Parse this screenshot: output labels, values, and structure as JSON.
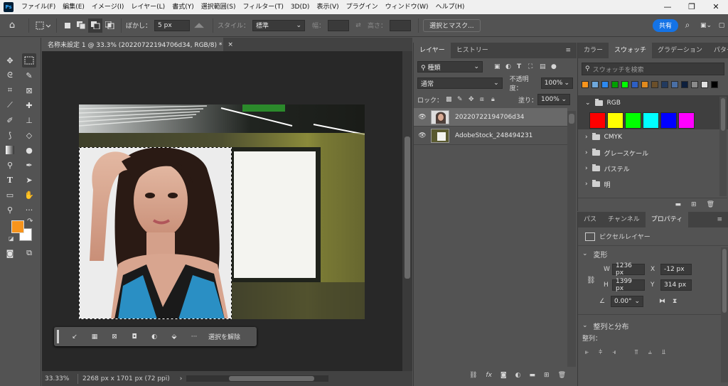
{
  "app": {
    "logo": "Ps"
  },
  "menu": [
    "ファイル(F)",
    "編集(E)",
    "イメージ(I)",
    "レイヤー(L)",
    "書式(Y)",
    "選択範囲(S)",
    "フィルター(T)",
    "3D(D)",
    "表示(V)",
    "プラグイン",
    "ウィンドウ(W)",
    "ヘルプ(H)"
  ],
  "window_controls": {
    "minimize": "—",
    "restore": "❐",
    "close": "✕"
  },
  "options": {
    "feather_label": "ぼかし：",
    "feather_value": "5 px",
    "style_label": "スタイル：",
    "style_value": "標準",
    "width_label": "幅：",
    "height_label": "高さ：",
    "select_mask": "選択とマスク...",
    "share": "共有"
  },
  "document": {
    "tab_title": "名称未設定 1 @ 33.3% (20220722194706d34, RGB/8) *",
    "zoom": "33.33%",
    "dimensions": "2268 px x 1701 px (72 ppi)"
  },
  "context_bar": {
    "deselect": "選択を解除"
  },
  "layers_panel": {
    "tabs": [
      "レイヤー",
      "ヒストリー"
    ],
    "filter_kind": "種類",
    "blend_mode": "通常",
    "opacity_label": "不透明度：",
    "opacity_value": "100%",
    "lock_label": "ロック：",
    "fill_label": "塗り：",
    "fill_value": "100%",
    "layers": [
      {
        "name": "20220722194706d34",
        "selected": true
      },
      {
        "name": "AdobeStock_248494231",
        "selected": false
      }
    ]
  },
  "swatches_panel": {
    "tabs": [
      "カラー",
      "スウォッチ",
      "グラデーション",
      "パターン"
    ],
    "search_placeholder": "スウォッチを検索",
    "recent_colors": [
      "#f7941d",
      "#6fa8dc",
      "#2d89ef",
      "#00a000",
      "#00ff00",
      "#2d5fc4",
      "#e08a1e",
      "#6b4f2a",
      "#223a5e",
      "#4a6fa5",
      "#0d1f3c",
      "#8a8a8a",
      "#e0e0e0",
      "#000000"
    ],
    "groups": [
      {
        "name": "RGB",
        "expanded": true,
        "colors": [
          "#ff0000",
          "#ffff00",
          "#00ff00",
          "#00ffff",
          "#0000ff",
          "#ff00ff"
        ]
      },
      {
        "name": "CMYK",
        "expanded": false
      },
      {
        "name": "グレースケール",
        "expanded": false
      },
      {
        "name": "パステル",
        "expanded": false
      },
      {
        "name": "明",
        "expanded": false
      }
    ]
  },
  "properties_panel": {
    "tabs": [
      "パス",
      "チャンネル",
      "プロパティ"
    ],
    "layer_type": "ピクセルレイヤー",
    "transform_title": "変形",
    "w_label": "W",
    "w_value": "1236 px",
    "x_label": "X",
    "x_value": "-12 px",
    "h_label": "H",
    "h_value": "1399 px",
    "y_label": "Y",
    "y_value": "314 px",
    "angle_value": "0.00°",
    "align_title": "整列と分布",
    "align_label": "整列："
  },
  "colors": {
    "foreground": "#f7941d",
    "background": "#ffffff",
    "accent": "#1473e6"
  }
}
